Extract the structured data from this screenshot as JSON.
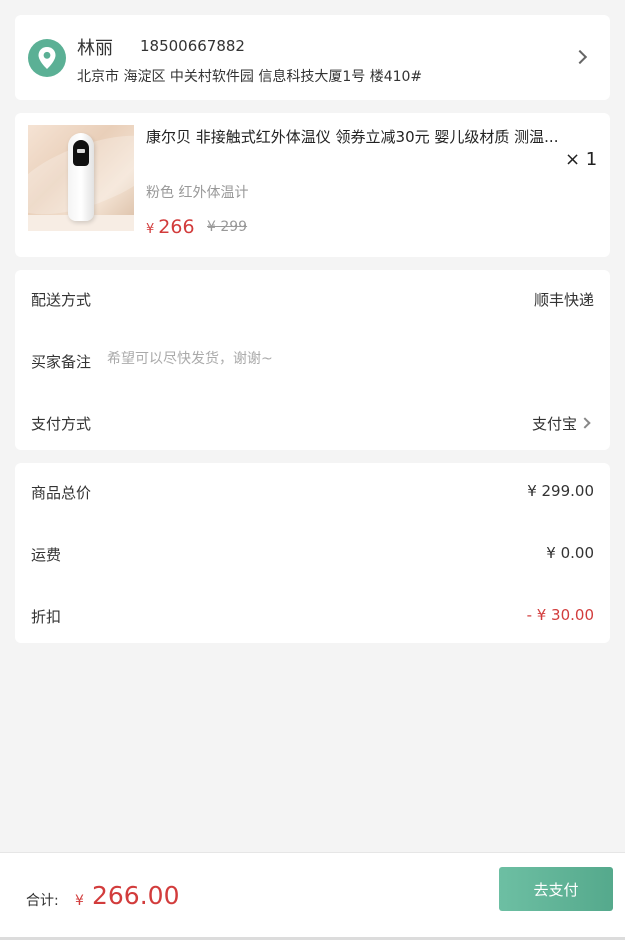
{
  "address": {
    "name": "林丽",
    "phone": "18500667882",
    "detail": "北京市 海淀区 中关村软件园 信息科技大厦1号 楼410#",
    "icon": "location-pin-icon"
  },
  "product": {
    "title": "康尔贝 非接触式红外体温仪 领券立减30元 婴儿级材质 测温...",
    "spec": "粉色 红外体温计",
    "price_symbol": "¥",
    "price": "266",
    "original_price": "¥ 299",
    "quantity": "× 1"
  },
  "options": {
    "delivery_label": "配送方式",
    "delivery_value": "顺丰快递",
    "remark_label": "买家备注",
    "remark_placeholder": "希望可以尽快发货，谢谢~",
    "remark_value": "",
    "payment_label": "支付方式",
    "payment_value": "支付宝"
  },
  "summary": {
    "goods_label": "商品总价",
    "goods_value": "¥ 299.00",
    "shipping_label": "运费",
    "shipping_value": "¥ 0.00",
    "discount_label": "折扣",
    "discount_value": "- ¥ 30.00"
  },
  "footer": {
    "total_label": "合计:",
    "total_symbol": "¥",
    "total_value": "266.00",
    "pay_button": "去支付"
  },
  "colors": {
    "accent": "#5bb095",
    "price": "#d23c3c",
    "background": "#f4f4f4"
  }
}
